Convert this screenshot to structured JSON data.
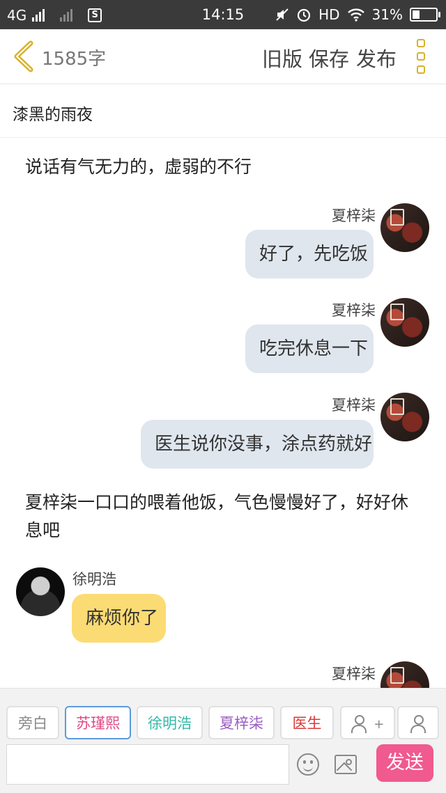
{
  "status_bar": {
    "network": "4G",
    "time": "14:15",
    "hd": "HD",
    "battery": "31%",
    "sim_icon": "S"
  },
  "header": {
    "word_count": "1585字",
    "old_version": "旧版",
    "save": "保存",
    "publish": "发布"
  },
  "story_title": "漆黑的雨夜",
  "chat": {
    "narration_1": "说话有气无力的，虚弱的不行",
    "msg_1": {
      "name": "夏梓柒",
      "text": "好了，先吃饭"
    },
    "msg_2": {
      "name": "夏梓柒",
      "text": "吃完休息一下"
    },
    "msg_3": {
      "name": "夏梓柒",
      "text": "医生说你没事，涂点药就好"
    },
    "narration_2": "夏梓柒一口口的喂着他饭，气色慢慢好了，好好休息吧",
    "msg_4": {
      "name": "徐明浩",
      "text": "麻烦你了"
    },
    "msg_5": {
      "name": "夏梓柒"
    }
  },
  "roles": [
    {
      "label": "旁白",
      "color": "#888888"
    },
    {
      "label": "苏瑾熙",
      "color": "#e04a86"
    },
    {
      "label": "徐明浩",
      "color": "#34b8a8"
    },
    {
      "label": "夏梓柒",
      "color": "#9a5cc4"
    },
    {
      "label": "医生",
      "color": "#d83a3a"
    }
  ],
  "add_role_plus": "+",
  "send": "发送"
}
